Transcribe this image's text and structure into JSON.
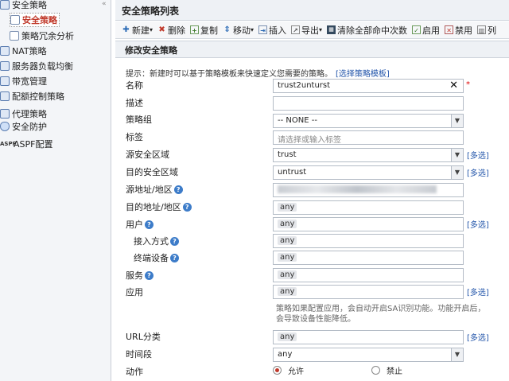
{
  "sidebar": {
    "items": [
      {
        "label": "安全策略",
        "icon": "folder-icon"
      },
      {
        "label": "安全策略",
        "icon": "doc-icon",
        "active": true
      },
      {
        "label": "策略冗余分析",
        "icon": "doc-icon"
      },
      {
        "label": "NAT策略",
        "icon": "nat-icon"
      },
      {
        "label": "服务器负载均衡",
        "icon": "server-icon"
      },
      {
        "label": "带宽管理",
        "icon": "bandwidth-icon"
      },
      {
        "label": "配额控制策略",
        "icon": "quota-icon"
      },
      {
        "label": "代理策略",
        "icon": "proxy-icon"
      },
      {
        "label": "安全防护",
        "icon": "shield-icon"
      },
      {
        "label": "ASPF配置",
        "icon": "aspf-icon",
        "icon_text": "ASPF"
      }
    ]
  },
  "panel": {
    "title": "安全策略列表"
  },
  "toolbar": {
    "new": "新建",
    "delete": "删除",
    "copy": "复制",
    "move": "移动",
    "insert": "插入",
    "export": "导出",
    "clear_hits": "清除全部命中次数",
    "enable": "启用",
    "disable": "禁用",
    "list": "列"
  },
  "dialog": {
    "title": "修改安全策略",
    "hint": "提示：新建时可以基于策略模板来快速定义您需要的策略。",
    "hint_link": "[选择策略模板]",
    "multi_select": "[多选]",
    "required_mark": "*",
    "fields": {
      "name": {
        "label": "名称",
        "value": "trust2unturst",
        "clear": "✕"
      },
      "description": {
        "label": "描述",
        "value": ""
      },
      "policy_group": {
        "label": "策略组",
        "value": "-- NONE --"
      },
      "tag": {
        "label": "标签",
        "placeholder": "请选择或输入标签"
      },
      "src_zone": {
        "label": "源安全区域",
        "value": "trust"
      },
      "dst_zone": {
        "label": "目的安全区域",
        "value": "untrust"
      },
      "src_addr": {
        "label": "源地址/地区"
      },
      "dst_addr": {
        "label": "目的地址/地区",
        "value": "any"
      },
      "user": {
        "label": "用户",
        "value": "any"
      },
      "access_mode": {
        "label": "接入方式",
        "value": "any"
      },
      "terminal": {
        "label": "终端设备",
        "value": "any"
      },
      "service": {
        "label": "服务",
        "value": "any"
      },
      "application": {
        "label": "应用",
        "value": "any"
      },
      "app_note": "策略如果配置应用，会自动开启SA识别功能。功能开启后，会导致设备性能降低。",
      "url_category": {
        "label": "URL分类",
        "value": "any"
      },
      "schedule": {
        "label": "时间段",
        "value": "any"
      },
      "action": {
        "label": "动作",
        "permit": "允许",
        "deny": "禁止",
        "selected": "permit"
      }
    }
  },
  "colors": {
    "accent": "#c0392b",
    "link": "#2255aa",
    "help": "#3d7cc9"
  }
}
